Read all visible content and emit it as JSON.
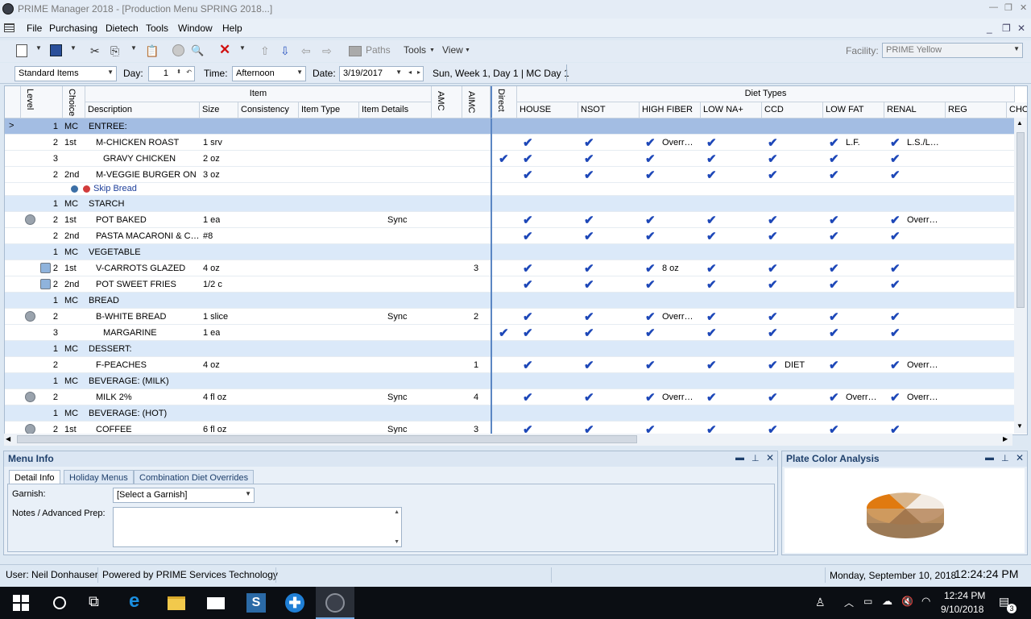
{
  "window": {
    "title": "PRIME Manager 2018 - [Production Menu SPRING 2018...]"
  },
  "menu": [
    "File",
    "Purchasing",
    "Dietech",
    "Tools",
    "Window",
    "Help"
  ],
  "toolbar": {
    "paths_label": "Paths",
    "tools_label": "Tools",
    "view_label": "View"
  },
  "facility": {
    "label": "Facility:",
    "value": "PRIME Yellow"
  },
  "filter": {
    "type_value": "Standard Items",
    "day_label": "Day:",
    "day_value": "1",
    "time_label": "Time:",
    "time_value": "Afternoon",
    "date_label": "Date:",
    "date_value": "3/19/2017",
    "summary": "Sun, Week 1, Day 1 | MC Day 1"
  },
  "grid": {
    "group_headers": {
      "item": "Item",
      "diet_types": "Diet Types"
    },
    "columns": {
      "level": "Level",
      "choice": "Choice",
      "description": "Description",
      "size": "Size",
      "consistency": "Consistency",
      "item_type": "Item Type",
      "item_details": "Item Details",
      "amc": "AMC",
      "aimc": "AIMC",
      "direct": "Direct",
      "diets": [
        "HOUSE",
        "NSOT",
        "HIGH FIBER",
        "LOW NA+",
        "CCD",
        "LOW FAT",
        "RENAL",
        "REG",
        "CHO"
      ]
    },
    "rows": [
      {
        "level": "1",
        "choice": "MC",
        "desc": "ENTREE:",
        "size": "",
        "details": "",
        "aimc": "",
        "direct": false,
        "group": true,
        "selected": true,
        "icon": "",
        "checks": [],
        "notes": {}
      },
      {
        "level": "2",
        "choice": "1st",
        "desc": "M-CHICKEN ROAST",
        "size": "1 srv",
        "details": "",
        "aimc": "",
        "direct": false,
        "group": false,
        "icon": "",
        "checks": [
          0,
          1,
          2,
          3,
          4,
          5,
          6
        ],
        "notes": {
          "2": "Overr…",
          "5": "L.F.",
          "6": "L.S./L…"
        }
      },
      {
        "level": "3",
        "choice": "",
        "desc": "GRAVY CHICKEN",
        "size": "2 oz",
        "details": "",
        "aimc": "",
        "direct": true,
        "group": false,
        "icon": "",
        "checks": [
          0,
          1,
          2,
          3,
          4,
          5,
          6
        ],
        "notes": {}
      },
      {
        "level": "2",
        "choice": "2nd",
        "desc": "M-VEGGIE BURGER ON …",
        "size": "3 oz",
        "details": "",
        "aimc": "",
        "direct": false,
        "group": false,
        "icon": "",
        "checks": [
          0,
          1,
          2,
          3,
          4,
          5,
          6
        ],
        "notes": {}
      },
      {
        "level": "",
        "choice": "",
        "desc": "Skip Bread",
        "size": "",
        "details": "",
        "aimc": "",
        "direct": false,
        "group": false,
        "icon": "",
        "skip": true,
        "checks": [],
        "notes": {}
      },
      {
        "level": "1",
        "choice": "MC",
        "desc": "STARCH",
        "size": "",
        "details": "",
        "aimc": "",
        "direct": false,
        "group": true,
        "icon": "",
        "checks": [],
        "notes": {}
      },
      {
        "level": "2",
        "choice": "1st",
        "desc": "POT BAKED",
        "size": "1 ea",
        "details": "Sync",
        "aimc": "",
        "direct": false,
        "group": false,
        "icon": "sync-icon",
        "checks": [
          0,
          1,
          2,
          3,
          4,
          5,
          6
        ],
        "notes": {
          "6": "Overr…"
        }
      },
      {
        "level": "2",
        "choice": "2nd",
        "desc": "PASTA MACARONI & C…",
        "size": "#8",
        "details": "",
        "aimc": "",
        "direct": false,
        "group": false,
        "icon": "",
        "checks": [
          0,
          1,
          2,
          3,
          4,
          5,
          6
        ],
        "notes": {}
      },
      {
        "level": "1",
        "choice": "MC",
        "desc": "VEGETABLE",
        "size": "",
        "details": "",
        "aimc": "",
        "direct": false,
        "group": true,
        "icon": "",
        "checks": [],
        "notes": {}
      },
      {
        "level": "2",
        "choice": "1st",
        "desc": "V-CARROTS GLAZED",
        "size": "4 oz",
        "details": "",
        "aimc": "3",
        "direct": false,
        "group": false,
        "icon": "recipe-icon",
        "checks": [
          0,
          1,
          2,
          3,
          4,
          5,
          6
        ],
        "notes": {
          "2": "8 oz"
        }
      },
      {
        "level": "2",
        "choice": "2nd",
        "desc": "POT SWEET FRIES",
        "size": "1/2 c",
        "details": "",
        "aimc": "",
        "direct": false,
        "group": false,
        "icon": "recipe-icon",
        "checks": [
          0,
          1,
          2,
          3,
          4,
          5,
          6
        ],
        "notes": {}
      },
      {
        "level": "1",
        "choice": "MC",
        "desc": "BREAD",
        "size": "",
        "details": "",
        "aimc": "",
        "direct": false,
        "group": true,
        "icon": "",
        "checks": [],
        "notes": {}
      },
      {
        "level": "2",
        "choice": "",
        "desc": "B-WHITE BREAD",
        "size": "1 slice",
        "details": "Sync",
        "aimc": "2",
        "direct": false,
        "group": false,
        "icon": "sync-icon",
        "checks": [
          0,
          1,
          2,
          3,
          4,
          5,
          6
        ],
        "notes": {
          "2": "Overr…"
        }
      },
      {
        "level": "3",
        "choice": "",
        "desc": "MARGARINE",
        "size": "1 ea",
        "details": "",
        "aimc": "",
        "direct": true,
        "group": false,
        "icon": "",
        "checks": [
          0,
          1,
          2,
          3,
          4,
          5,
          6
        ],
        "notes": {}
      },
      {
        "level": "1",
        "choice": "MC",
        "desc": "DESSERT:",
        "size": "",
        "details": "",
        "aimc": "",
        "direct": false,
        "group": true,
        "icon": "",
        "checks": [],
        "notes": {}
      },
      {
        "level": "2",
        "choice": "",
        "desc": "F-PEACHES",
        "size": "4 oz",
        "details": "",
        "aimc": "1",
        "direct": false,
        "group": false,
        "icon": "",
        "checks": [
          0,
          1,
          2,
          3,
          4,
          5,
          6
        ],
        "notes": {
          "4": "DIET",
          "6": "Overr…"
        }
      },
      {
        "level": "1",
        "choice": "MC",
        "desc": "BEVERAGE: (MILK)",
        "size": "",
        "details": "",
        "aimc": "",
        "direct": false,
        "group": true,
        "icon": "",
        "checks": [],
        "notes": {}
      },
      {
        "level": "2",
        "choice": "",
        "desc": "MILK  2%",
        "size": "4 fl oz",
        "details": "Sync",
        "aimc": "4",
        "direct": false,
        "group": false,
        "icon": "sync-icon",
        "checks": [
          0,
          1,
          2,
          3,
          4,
          5,
          6
        ],
        "notes": {
          "2": "Overr…",
          "5": "Overr…",
          "6": "Overr…"
        }
      },
      {
        "level": "1",
        "choice": "MC",
        "desc": "BEVERAGE: (HOT)",
        "size": "",
        "details": "",
        "aimc": "",
        "direct": false,
        "group": true,
        "icon": "",
        "checks": [],
        "notes": {}
      },
      {
        "level": "2",
        "choice": "1st",
        "desc": "COFFEE",
        "size": "6 fl oz",
        "details": "Sync",
        "aimc": "3",
        "direct": false,
        "group": false,
        "icon": "sync-icon",
        "checks": [
          0,
          1,
          2,
          3,
          4,
          5,
          6
        ],
        "notes": {}
      }
    ]
  },
  "menu_info": {
    "title": "Menu Info",
    "tabs": [
      "Detail Info",
      "Holiday Menus",
      "Combination Diet Overrides"
    ],
    "garnish_label": "Garnish:",
    "garnish_value": "[Select a Garnish]",
    "notes_label": "Notes / Advanced Prep:"
  },
  "plate": {
    "title": "Plate Color Analysis"
  },
  "status": {
    "user": "User: Neil Donhauser",
    "powered": "Powered by PRIME Services Technology",
    "date": "Monday, September 10, 2018",
    "time": "12:24:24 PM"
  },
  "taskbar": {
    "time": "12:24 PM",
    "date": "9/10/2018",
    "notif_count": "3"
  },
  "colors": {
    "accent": "#1d47b8",
    "group_row": "#dbe9f9",
    "selected_row": "#a3bde3"
  }
}
